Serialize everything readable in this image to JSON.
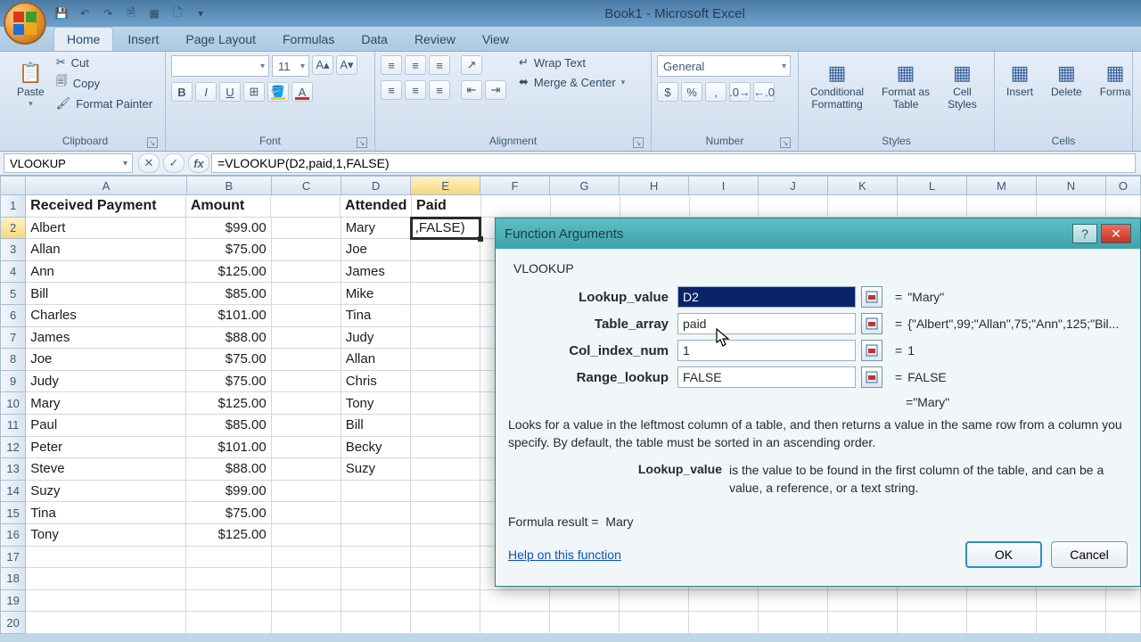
{
  "titlebar": {
    "title": "Book1 - Microsoft Excel"
  },
  "tabs": [
    "Home",
    "Insert",
    "Page Layout",
    "Formulas",
    "Data",
    "Review",
    "View"
  ],
  "active_tab": "Home",
  "ribbon": {
    "paste": "Paste",
    "cut": "Cut",
    "copy": "Copy",
    "fmtpainter": "Format Painter",
    "clipboard_label": "Clipboard",
    "font_size": "11",
    "font_label": "Font",
    "wrap": "Wrap Text",
    "merge": "Merge & Center",
    "align_label": "Alignment",
    "numfmt": "General",
    "number_label": "Number",
    "cond": "Conditional\nFormatting",
    "fmttable": "Format as\nTable",
    "cellstyles": "Cell\nStyles",
    "styles_label": "Styles",
    "insert": "Insert",
    "delete": "Delete",
    "format": "Forma",
    "cells_label": "Cells"
  },
  "namebox": "VLOOKUP",
  "formula": "=VLOOKUP(D2,paid,1,FALSE)",
  "columns": [
    "A",
    "B",
    "C",
    "D",
    "E",
    "F",
    "G",
    "H",
    "I",
    "J",
    "K",
    "L",
    "M",
    "N",
    "O"
  ],
  "headers": {
    "A": "Received Payment",
    "B": "Amount",
    "D": "Attended",
    "E": "Paid"
  },
  "rows": [
    {
      "n": 1,
      "A": "Received Payment",
      "B": "Amount",
      "D": "Attended",
      "E": "Paid",
      "hdr": true
    },
    {
      "n": 2,
      "A": "Albert",
      "B": "$99.00",
      "D": "Mary",
      "E": ",FALSE)"
    },
    {
      "n": 3,
      "A": "Allan",
      "B": "$75.00",
      "D": "Joe"
    },
    {
      "n": 4,
      "A": "Ann",
      "B": "$125.00",
      "D": "James"
    },
    {
      "n": 5,
      "A": "Bill",
      "B": "$85.00",
      "D": "Mike"
    },
    {
      "n": 6,
      "A": "Charles",
      "B": "$101.00",
      "D": "Tina"
    },
    {
      "n": 7,
      "A": "James",
      "B": "$88.00",
      "D": "Judy"
    },
    {
      "n": 8,
      "A": "Joe",
      "B": "$75.00",
      "D": "Allan"
    },
    {
      "n": 9,
      "A": "Judy",
      "B": "$75.00",
      "D": "Chris"
    },
    {
      "n": 10,
      "A": "Mary",
      "B": "$125.00",
      "D": "Tony"
    },
    {
      "n": 11,
      "A": "Paul",
      "B": "$85.00",
      "D": "Bill"
    },
    {
      "n": 12,
      "A": "Peter",
      "B": "$101.00",
      "D": "Becky"
    },
    {
      "n": 13,
      "A": "Steve",
      "B": "$88.00",
      "D": "Suzy"
    },
    {
      "n": 14,
      "A": "Suzy",
      "B": "$99.00"
    },
    {
      "n": 15,
      "A": "Tina",
      "B": "$75.00"
    },
    {
      "n": 16,
      "A": "Tony",
      "B": "$125.00"
    },
    {
      "n": 17
    },
    {
      "n": 18
    },
    {
      "n": 19
    },
    {
      "n": 20
    }
  ],
  "dialog": {
    "title": "Function Arguments",
    "func": "VLOOKUP",
    "args": [
      {
        "label": "Lookup_value",
        "value": "D2",
        "eval": "\"Mary\"",
        "sel": true
      },
      {
        "label": "Table_array",
        "value": "paid",
        "eval": "{\"Albert\",99;\"Allan\",75;\"Ann\",125;\"Bil..."
      },
      {
        "label": "Col_index_num",
        "value": "1",
        "eval": "1"
      },
      {
        "label": "Range_lookup",
        "value": "FALSE",
        "eval": "FALSE"
      }
    ],
    "result_eval": "\"Mary\"",
    "desc": "Looks for a value in the leftmost column of a table, and then returns a value in the same row from a column you specify. By default, the table must be sorted in an ascending order.",
    "param_name": "Lookup_value",
    "param_desc": "is the value to be found in the first column of the table, and can be a value, a reference, or a text string.",
    "formula_result_label": "Formula result =",
    "formula_result": "Mary",
    "help": "Help on this function",
    "ok": "OK",
    "cancel": "Cancel"
  }
}
